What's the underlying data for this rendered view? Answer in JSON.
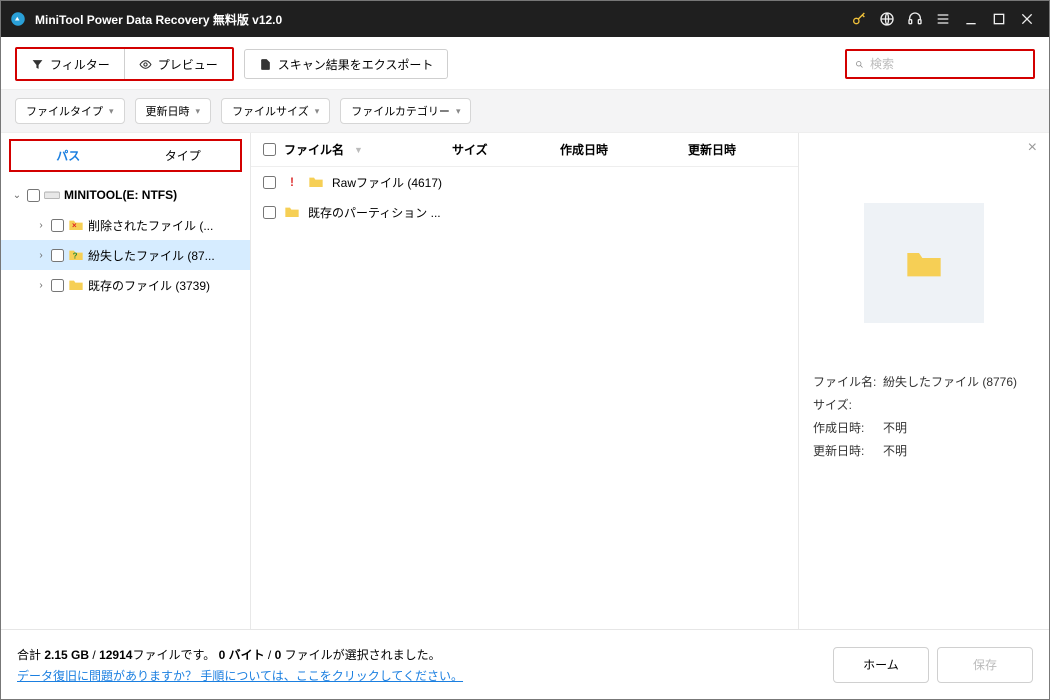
{
  "title": "MiniTool Power Data Recovery 無料版 v12.0",
  "toolbar": {
    "filter": "フィルター",
    "preview": "プレビュー",
    "export": "スキャン結果をエクスポート"
  },
  "search": {
    "placeholder": "検索"
  },
  "filters": {
    "filetype": "ファイルタイプ",
    "modified": "更新日時",
    "filesize": "ファイルサイズ",
    "category": "ファイルカテゴリー"
  },
  "tabs": {
    "path": "パス",
    "type": "タイプ"
  },
  "tree": {
    "root": "MINITOOL(E: NTFS)",
    "items": [
      {
        "label": "削除されたファイル (...",
        "kind": "deleted"
      },
      {
        "label": "紛失したファイル (87...",
        "kind": "lost",
        "selected": true
      },
      {
        "label": "既存のファイル (3739)",
        "kind": "existing"
      }
    ]
  },
  "columns": {
    "name": "ファイル名",
    "size": "サイズ",
    "created": "作成日時",
    "modified": "更新日時"
  },
  "rows": [
    {
      "label": "Rawファイル (4617)",
      "warn": true
    },
    {
      "label": "既存のパーティション ...",
      "warn": false
    }
  ],
  "preview": {
    "filename_label": "ファイル名:",
    "filename": "紛失したファイル (8776)",
    "size_label": "サイズ:",
    "size": "",
    "created_label": "作成日時:",
    "created": "不明",
    "modified_label": "更新日時:",
    "modified": "不明"
  },
  "footer": {
    "summary_prefix": "合計 ",
    "total_size": "2.15 GB",
    "sep1": " / ",
    "total_files": "12914",
    "files_suffix": "ファイルです。 ",
    "sel_bytes": "0 バイト",
    "sep2": "  /  ",
    "sel_count": "0",
    "sel_suffix": " ファイルが選択されました。",
    "help_link": "データ復旧に問題がありますか？ 手順については、ここをクリックしてください。",
    "home": "ホーム",
    "save": "保存"
  }
}
